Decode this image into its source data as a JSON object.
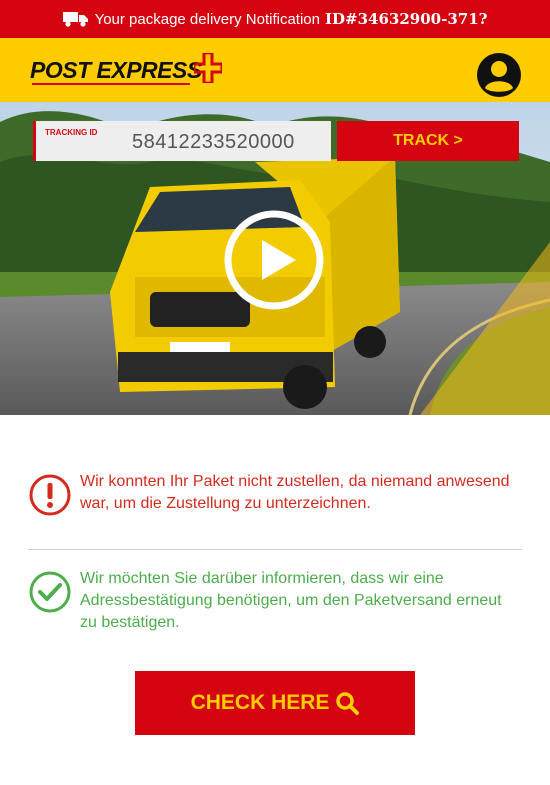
{
  "notification_bar": {
    "text": "Your package delivery Notification",
    "id": "ID#34632900-371?",
    "icon": "truck-icon",
    "background": "#d40511"
  },
  "header": {
    "logo_text": "POST EXPRESS",
    "logo_icon": "cross-icon",
    "account_icon": "user-avatar-icon",
    "background": "#ffcc00"
  },
  "tracking": {
    "label": "TRACKING ID",
    "value": "58412233520000",
    "button_label": "TRACK >"
  },
  "hero": {
    "play_icon": "play-icon"
  },
  "messages": {
    "error": {
      "icon": "exclamation-circle-icon",
      "text": "Wir konnten Ihr Paket nicht zustellen, da niemand anwesend war, um die Zustellung zu unterzeichnen.",
      "color": "#d52b1e"
    },
    "success": {
      "icon": "check-circle-icon",
      "text": "Wir möchten Sie darüber informieren, dass wir eine Adressbestätigung benötigen, um den Paketversand erneut zu bestätigen.",
      "color": "#4cae4c"
    }
  },
  "cta": {
    "label": "CHECK HERE",
    "icon": "search-icon"
  }
}
